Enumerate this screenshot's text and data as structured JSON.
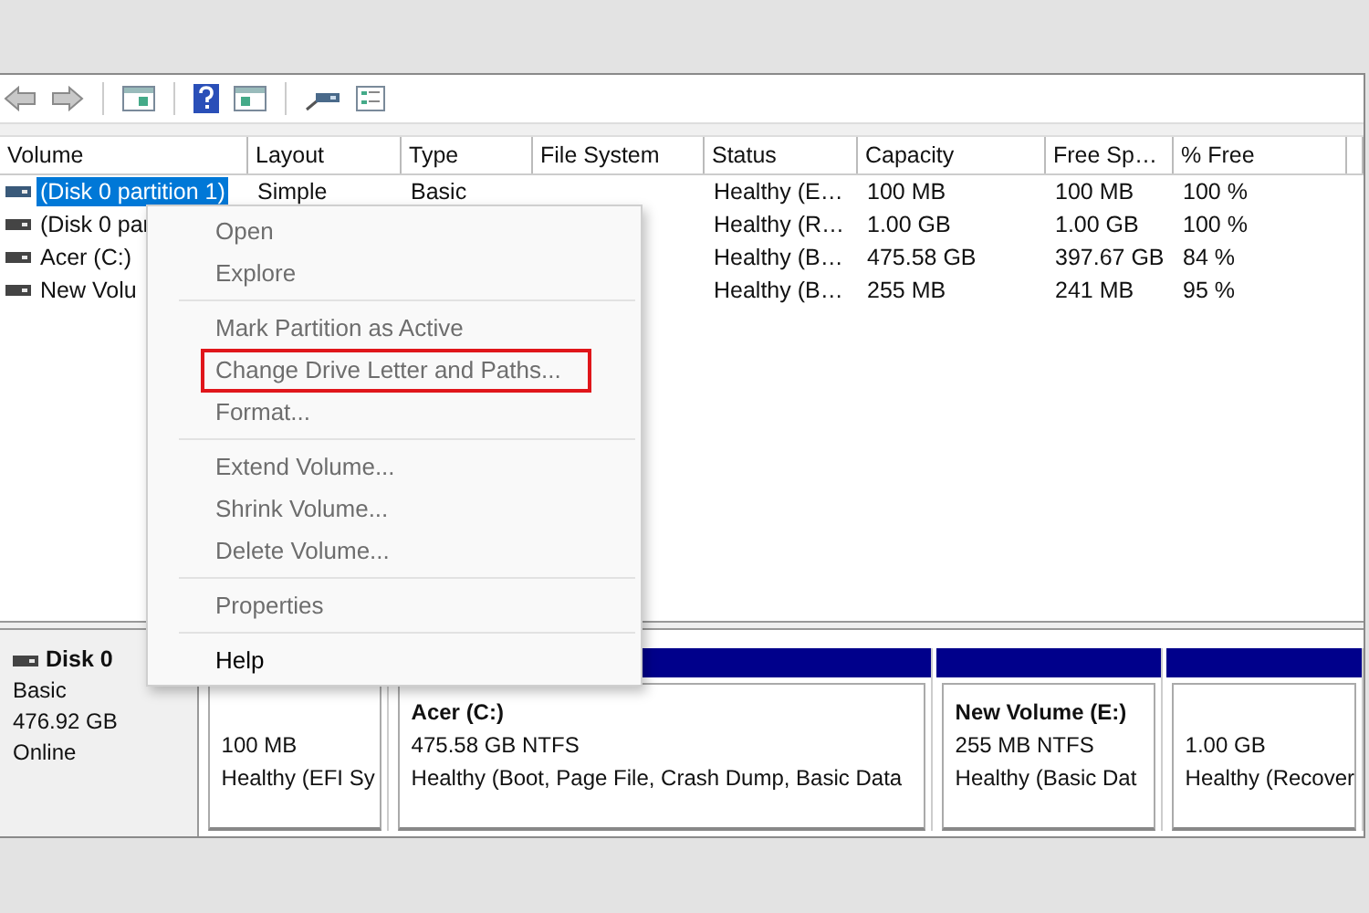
{
  "table": {
    "columns": [
      "Volume",
      "Layout",
      "Type",
      "File System",
      "Status",
      "Capacity",
      "Free Sp…",
      "% Free"
    ],
    "rows": [
      {
        "selected": true,
        "volume": "(Disk 0 partition 1)",
        "layout": "Simple",
        "type": "Basic",
        "status": "Healthy (E…",
        "capacity": "100 MB",
        "free_space": "100 MB",
        "percent_free": "100 %"
      },
      {
        "selected": false,
        "volume": "(Disk 0 par",
        "status": "Healthy (R…",
        "capacity": "1.00 GB",
        "free_space": "1.00 GB",
        "percent_free": "100 %"
      },
      {
        "selected": false,
        "volume": "Acer (C:)",
        "status": "Healthy (B…",
        "capacity": "475.58 GB",
        "free_space": "397.67 GB",
        "percent_free": "84 %"
      },
      {
        "selected": false,
        "volume": "New Volu",
        "status": "Healthy (B…",
        "capacity": "255 MB",
        "free_space": "241 MB",
        "percent_free": "95 %"
      }
    ]
  },
  "disk": {
    "name": "Disk 0",
    "type": "Basic",
    "size": "476.92 GB",
    "status": "Online"
  },
  "partitions": [
    {
      "size": "100 MB",
      "status": "Healthy (EFI Sy"
    },
    {
      "name": "Acer  (C:)",
      "size": "475.58 GB NTFS",
      "status": "Healthy (Boot, Page File, Crash Dump, Basic Data"
    },
    {
      "name": "New Volume  (E:)",
      "size": "255 MB NTFS",
      "status": "Healthy (Basic Dat"
    },
    {
      "size": "1.00 GB",
      "status": "Healthy (Recover"
    }
  ],
  "context_menu": {
    "items": [
      {
        "kind": "item",
        "label": "Open",
        "disabled": true,
        "highlighted": false
      },
      {
        "kind": "item",
        "label": "Explore",
        "disabled": true,
        "highlighted": false
      },
      {
        "kind": "separator"
      },
      {
        "kind": "item",
        "label": "Mark Partition as Active",
        "disabled": true,
        "highlighted": false
      },
      {
        "kind": "item",
        "label": "Change Drive Letter and Paths...",
        "disabled": true,
        "highlighted": true
      },
      {
        "kind": "item",
        "label": "Format...",
        "disabled": true,
        "highlighted": false
      },
      {
        "kind": "separator"
      },
      {
        "kind": "item",
        "label": "Extend Volume...",
        "disabled": true,
        "highlighted": false
      },
      {
        "kind": "item",
        "label": "Shrink Volume...",
        "disabled": true,
        "highlighted": false
      },
      {
        "kind": "item",
        "label": "Delete Volume...",
        "disabled": true,
        "highlighted": false
      },
      {
        "kind": "separator"
      },
      {
        "kind": "item",
        "label": "Properties",
        "disabled": true,
        "highlighted": false
      },
      {
        "kind": "separator"
      },
      {
        "kind": "item",
        "label": "Help",
        "disabled": false,
        "highlighted": false
      }
    ]
  }
}
